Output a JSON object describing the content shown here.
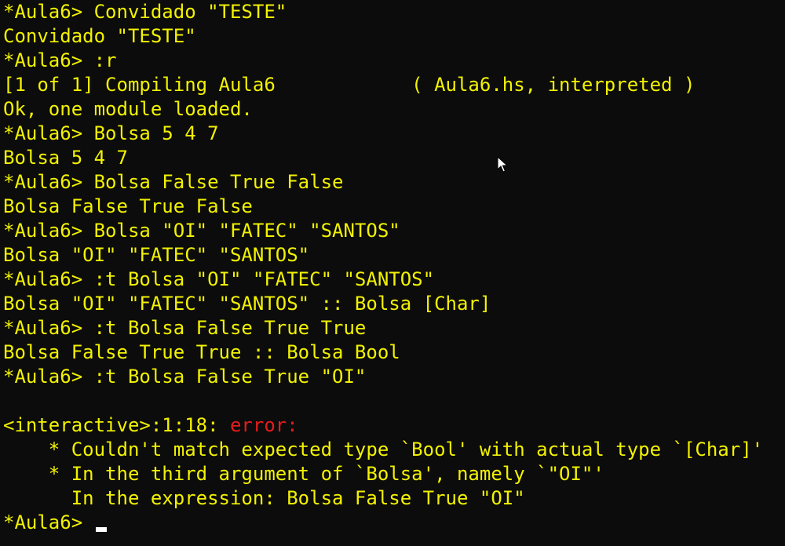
{
  "terminal": {
    "lines": [
      "*Aula6> Convidado \"TESTE\"",
      "Convidado \"TESTE\"",
      "*Aula6> :r",
      "[1 of 1] Compiling Aula6            ( Aula6.hs, interpreted )",
      "Ok, one module loaded.",
      "*Aula6> Bolsa 5 4 7",
      "Bolsa 5 4 7",
      "*Aula6> Bolsa False True False",
      "Bolsa False True False",
      "*Aula6> Bolsa \"OI\" \"FATEC\" \"SANTOS\"",
      "Bolsa \"OI\" \"FATEC\" \"SANTOS\"",
      "*Aula6> :t Bolsa \"OI\" \"FATEC\" \"SANTOS\"",
      "Bolsa \"OI\" \"FATEC\" \"SANTOS\" :: Bolsa [Char]",
      "*Aula6> :t Bolsa False True True",
      "Bolsa False True True :: Bolsa Bool",
      "*Aula6> :t Bolsa False True \"OI\"",
      ""
    ],
    "error_location": "<interactive>:1:18: ",
    "error_label": "error:",
    "error_details": [
      "    * Couldn't match expected type `Bool' with actual type `[Char]'",
      "    * In the third argument of `Bolsa', namely `\"OI\"'",
      "      In the expression: Bolsa False True \"OI\""
    ],
    "prompt": "*Aula6> ",
    "colors": {
      "background": "#0c0c0c",
      "text": "#f2f200",
      "error": "#e81b1b",
      "cursor": "#ffffff"
    },
    "pointer_icon": "mouse-pointer-icon"
  }
}
